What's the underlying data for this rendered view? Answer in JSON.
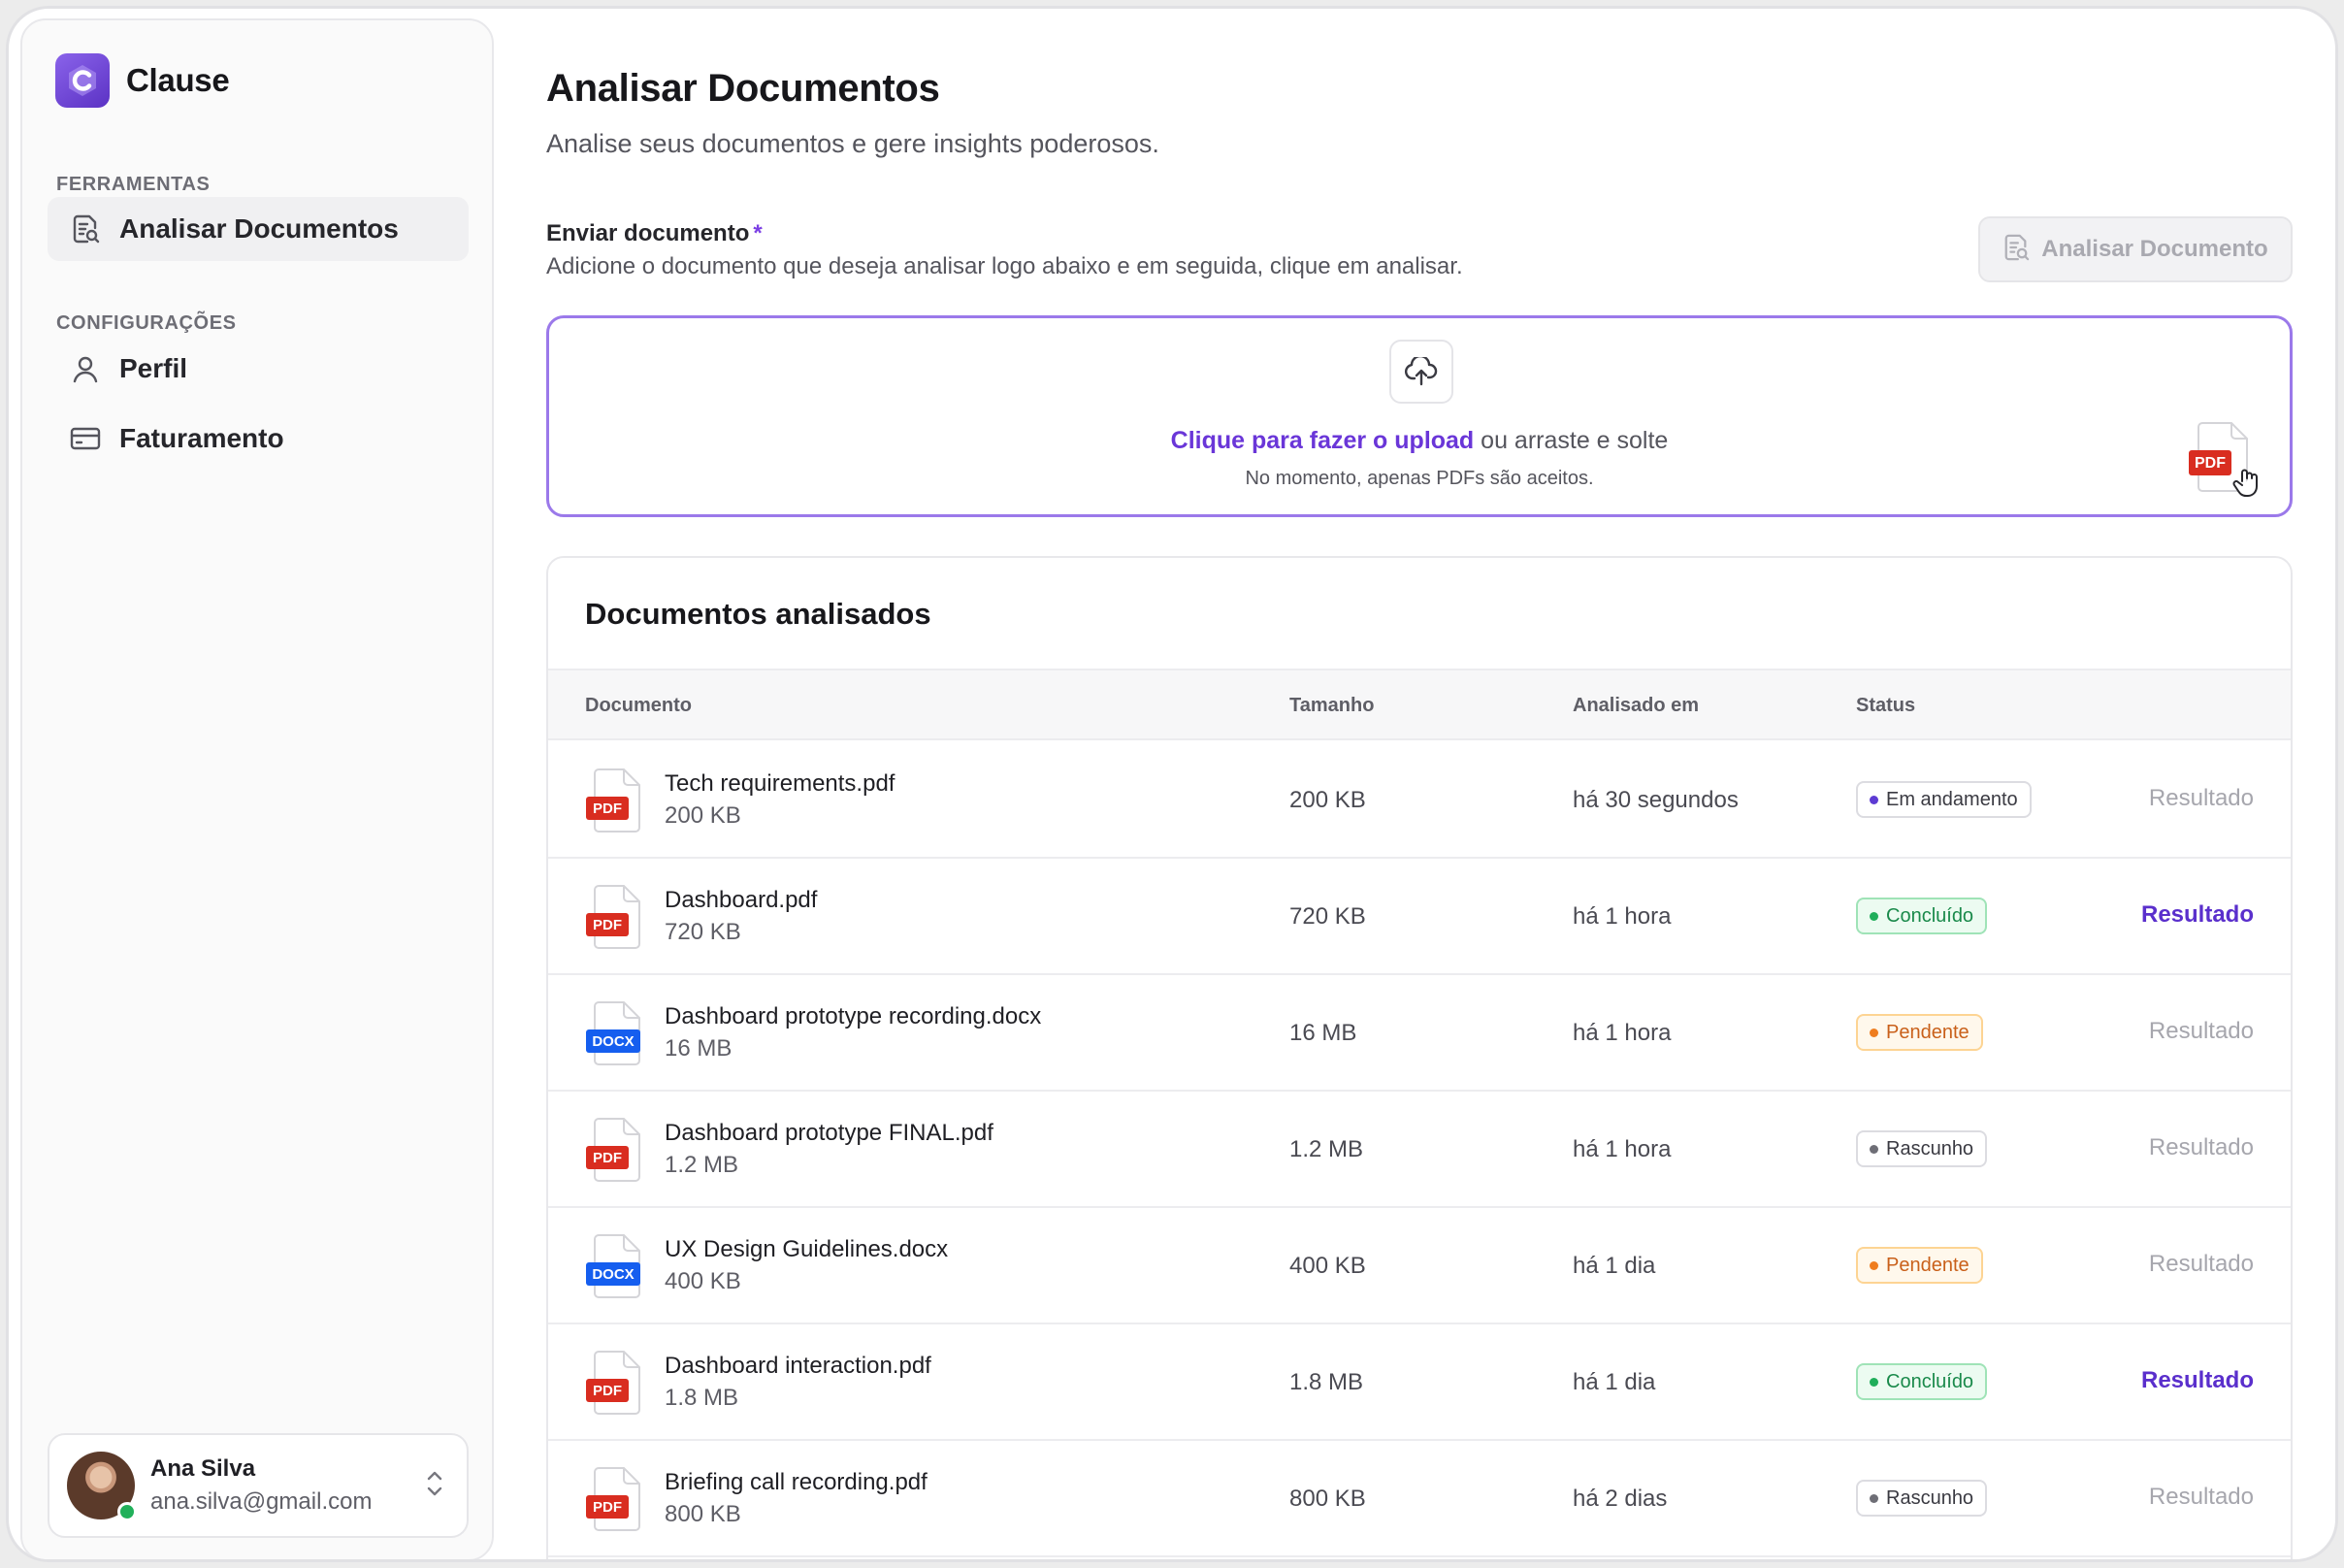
{
  "brand": {
    "name": "Clause"
  },
  "sidebar": {
    "sections": [
      {
        "label": "FERRAMENTAS",
        "items": [
          {
            "label": "Analisar Documentos",
            "icon": "document-search-icon",
            "active": true
          }
        ]
      },
      {
        "label": "CONFIGURAÇÕES",
        "items": [
          {
            "label": "Perfil",
            "icon": "user-icon",
            "active": false
          },
          {
            "label": "Faturamento",
            "icon": "credit-card-icon",
            "active": false
          }
        ]
      }
    ]
  },
  "user": {
    "name": "Ana Silva",
    "email": "ana.silva@gmail.com",
    "online": true
  },
  "page": {
    "title": "Analisar Documentos",
    "subtitle": "Analise seus documentos e gere insights poderosos."
  },
  "upload": {
    "label": "Enviar documento",
    "required_mark": "*",
    "description": "Adicione o documento que deseja analisar logo abaixo e em seguida, clique em analisar.",
    "analyze_button": "Analisar Documento",
    "link_text": "Clique para fazer o upload",
    "rest_text": " ou arraste e solte",
    "note": "No momento, apenas PDFs são aceitos.",
    "drag_file_type": "PDF"
  },
  "documents": {
    "title": "Documentos analisados",
    "columns": {
      "document": "Documento",
      "size": "Tamanho",
      "analyzed_at": "Analisado em",
      "status": "Status"
    },
    "rows": [
      {
        "type": "PDF",
        "name": "Tech requirements.pdf",
        "size": "200 KB",
        "analyzed_at": "há 30 segundos",
        "status": "Em andamento",
        "status_kind": "progress",
        "result": "Resultado",
        "result_enabled": false
      },
      {
        "type": "PDF",
        "name": "Dashboard.pdf",
        "size": "720 KB",
        "analyzed_at": "há 1 hora",
        "status": "Concluído",
        "status_kind": "done",
        "result": "Resultado",
        "result_enabled": true
      },
      {
        "type": "DOCX",
        "name": "Dashboard prototype recording.docx",
        "size": "16 MB",
        "analyzed_at": "há 1 hora",
        "status": "Pendente",
        "status_kind": "pending",
        "result": "Resultado",
        "result_enabled": false
      },
      {
        "type": "PDF",
        "name": "Dashboard prototype FINAL.pdf",
        "size": "1.2 MB",
        "analyzed_at": "há 1 hora",
        "status": "Rascunho",
        "status_kind": "draft",
        "result": "Resultado",
        "result_enabled": false
      },
      {
        "type": "DOCX",
        "name": "UX Design Guidelines.docx",
        "size": "400 KB",
        "analyzed_at": "há 1 dia",
        "status": "Pendente",
        "status_kind": "pending",
        "result": "Resultado",
        "result_enabled": false
      },
      {
        "type": "PDF",
        "name": "Dashboard interaction.pdf",
        "size": "1.8 MB",
        "analyzed_at": "há 1 dia",
        "status": "Concluído",
        "status_kind": "done",
        "result": "Resultado",
        "result_enabled": true
      },
      {
        "type": "PDF",
        "name": "Briefing call recording.pdf",
        "size": "800 KB",
        "analyzed_at": "há 2 dias",
        "status": "Rascunho",
        "status_kind": "draft",
        "result": "Resultado",
        "result_enabled": false
      }
    ]
  },
  "colors": {
    "accent": "#6a36d8",
    "pdf": "#d92d20",
    "docx": "#155eef",
    "done": "#1a8a4b",
    "pending": "#c9601a"
  }
}
